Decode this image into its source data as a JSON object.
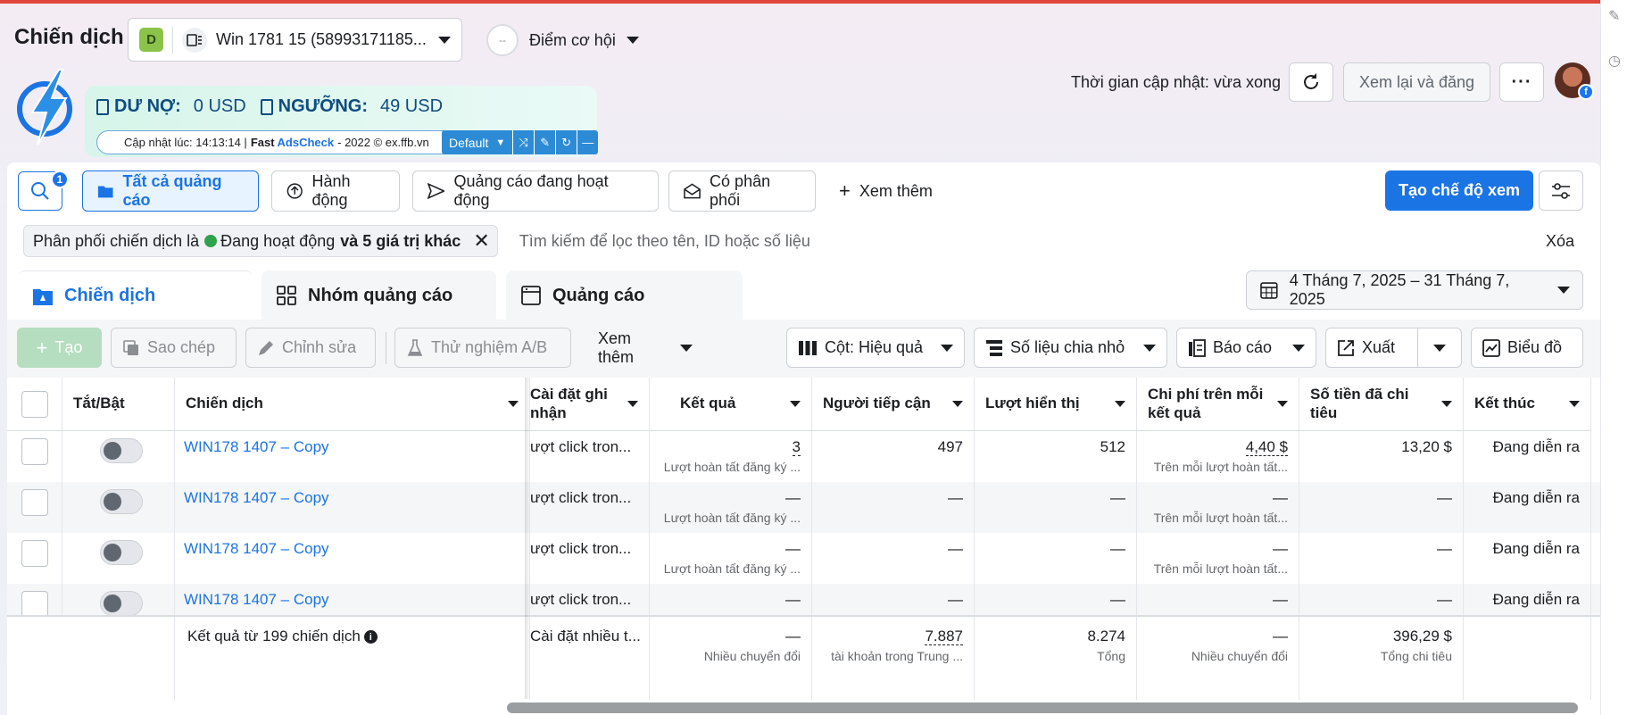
{
  "page": {
    "title": "Chiến dịch"
  },
  "account": {
    "badge": "D",
    "name": "Win 1781 15 (58993171185..."
  },
  "opportunity": {
    "score": "--",
    "label": "Điểm cơ hội"
  },
  "extension": {
    "debt_label": "DƯ NỢ:",
    "debt_value": "0 USD",
    "threshold_label": "NGƯỠNG:",
    "threshold_value": "49 USD",
    "updated_prefix": "Cập nhật lúc: 14:13:14 |",
    "brand_fast": "Fast",
    "brand_adscheck": "AdsCheck",
    "updated_suffix": "- 2022 © ex.ffb.vn",
    "preset": "Default"
  },
  "header": {
    "update_status": "Thời gian cập nhật: vừa xong",
    "review_button": "Xem lại và đăng",
    "more_button": "···"
  },
  "filters": {
    "search_badge": "1",
    "chips": [
      "Tất cả quảng cáo",
      "Hành động",
      "Quảng cáo đang hoạt động",
      "Có phân phối",
      "Xem thêm"
    ],
    "create_view": "Tạo chế độ xem",
    "filter_prefix": "Phân phối chiến dịch là",
    "filter_status": "Đang hoạt động",
    "filter_more": "và 5 giá trị khác",
    "search_placeholder": "Tìm kiếm để lọc theo tên, ID hoặc số liệu",
    "clear": "Xóa"
  },
  "tabs": [
    "Chiến dịch",
    "Nhóm quảng cáo",
    "Quảng cáo"
  ],
  "date_range": "4 Tháng 7, 2025 – 31 Tháng 7, 2025",
  "toolbar": {
    "create": "Tạo",
    "copy": "Sao chép",
    "edit": "Chỉnh sửa",
    "ab_test": "Thử nghiệm A/B",
    "see_more": "Xem thêm",
    "columns": "Cột: Hiệu quả",
    "breakdown": "Số liệu chia nhỏ",
    "reports": "Báo cáo",
    "export": "Xuất",
    "chart": "Biểu đồ"
  },
  "table": {
    "headers": {
      "toggle": "Tắt/Bật",
      "campaign": "Chiến dịch",
      "attribution": "Cài đặt ghi nhận",
      "results": "Kết quả",
      "reach": "Người tiếp cận",
      "impressions": "Lượt hiển thị",
      "cost_per_result": "Chi phí trên mỗi kết quả",
      "amount_spent": "Số tiền đã chi tiêu",
      "ends": "Kết thúc"
    },
    "rows": [
      {
        "name": "WIN178 1407 – Copy",
        "attribution": "ượt click tron...",
        "results": "3",
        "results_sub": "Lượt hoàn tất đăng ký ...",
        "reach": "497",
        "impressions": "512",
        "cpr": "4,40 $",
        "cpr_sub": "Trên mỗi lượt hoàn tất...",
        "spent": "13,20 $",
        "ends": "Đang diễn ra"
      },
      {
        "name": "WIN178 1407 – Copy",
        "attribution": "ượt click tron...",
        "results": "—",
        "results_sub": "Lượt hoàn tất đăng ký ...",
        "reach": "—",
        "impressions": "—",
        "cpr": "—",
        "cpr_sub": "Trên mỗi lượt hoàn tất...",
        "spent": "—",
        "ends": "Đang diễn ra"
      },
      {
        "name": "WIN178 1407 – Copy",
        "attribution": "ượt click tron...",
        "results": "—",
        "results_sub": "Lượt hoàn tất đăng ký ...",
        "reach": "—",
        "impressions": "—",
        "cpr": "—",
        "cpr_sub": "Trên mỗi lượt hoàn tất...",
        "spent": "—",
        "ends": "Đang diễn ra"
      },
      {
        "name": "WIN178 1407 – Copy",
        "attribution": "ượt click tron...",
        "results": "—",
        "results_sub": "",
        "reach": "—",
        "impressions": "—",
        "cpr": "—",
        "cpr_sub": "",
        "spent": "—",
        "ends": "Đang diễn ra"
      }
    ],
    "footer": {
      "label": "Kết quả từ 199 chiến dịch",
      "attribution": "Cài đặt nhiều t...",
      "results": "—",
      "results_sub": "Nhiều chuyển đổi",
      "reach": "7.887",
      "reach_sub": "tài khoản trong Trung ...",
      "impressions": "8.274",
      "impressions_sub": "Tổng",
      "cpr": "—",
      "cpr_sub": "Nhiều chuyển đổi",
      "spent": "396,29 $",
      "spent_sub": "Tổng chi tiêu"
    }
  },
  "colors": {
    "accent": "#1b74e4",
    "active_green": "#31a24c",
    "top_bar": "#e0463a"
  }
}
